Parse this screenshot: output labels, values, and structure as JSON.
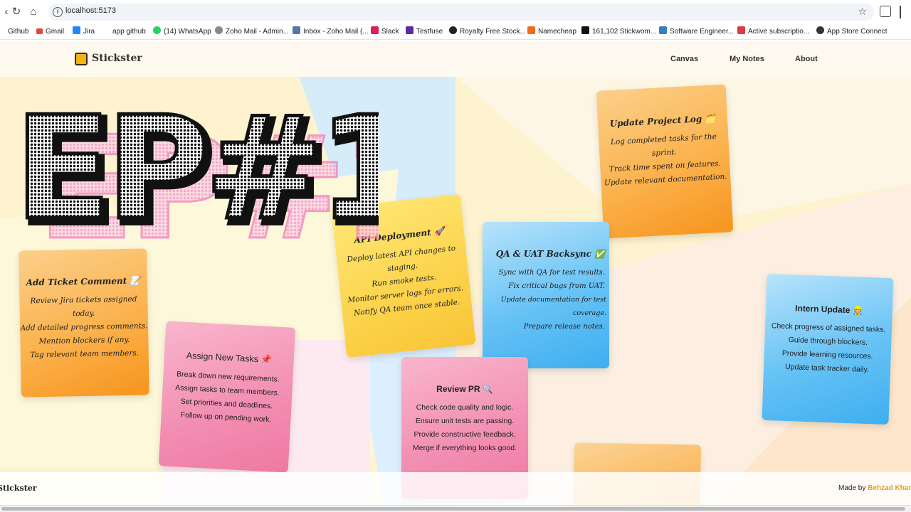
{
  "browser": {
    "url": "localhost:5173",
    "bookmarks": [
      {
        "label": "Github",
        "color": "#333333"
      },
      {
        "label": "Gmail",
        "color": "#ea4335"
      },
      {
        "label": "Jira",
        "color": "#2684ff"
      },
      {
        "label": "app github",
        "color": "#ffffff"
      },
      {
        "label": "(14) WhatsApp",
        "color": "#25d366"
      },
      {
        "label": "Zoho Mail - Admin...",
        "color": "#777777"
      },
      {
        "label": "Inbox - Zoho Mail (...",
        "color": "#5577aa"
      },
      {
        "label": "Slack",
        "color": "#e01e5a"
      },
      {
        "label": "Testfuse",
        "color": "#5a2ca0"
      },
      {
        "label": "Royalty Free Stock...",
        "color": "#222222"
      },
      {
        "label": "Namecheap",
        "color": "#f26a1b"
      },
      {
        "label": "161,102 Stickwom...",
        "color": "#111111"
      },
      {
        "label": "Software Engineer...",
        "color": "#3b7bbf"
      },
      {
        "label": "Active subscriptio...",
        "color": "#e0393e"
      },
      {
        "label": "App Store Connect",
        "color": "#333333"
      }
    ]
  },
  "app": {
    "brand": "Stickster",
    "nav": [
      "Canvas",
      "My Notes",
      "About"
    ],
    "footer_brand": "Stickster",
    "footer_made": "Made by",
    "footer_author": "Behzad Khan"
  },
  "overlay_text": "EP#1",
  "notes": [
    {
      "title": "Update Project Log 🗂️",
      "lines": [
        "Log completed tasks for the sprint.",
        "Track time spent on features.",
        "Update relevant documentation."
      ],
      "color": "orange"
    },
    {
      "title": "API Deployment 🚀",
      "lines": [
        "Deploy latest API changes to staging.",
        "Run smoke tests.",
        "Monitor server logs for errors.",
        "Notify QA team once stable."
      ],
      "color": "yellow"
    },
    {
      "title": "QA & UAT Backsync ✅",
      "lines": [
        "Sync with QA for test results.",
        "Fix critical bugs from UAT.",
        "Update documentation for test coverage.",
        "Prepare release notes."
      ],
      "color": "blue"
    },
    {
      "title": "Add Ticket Comment 📝",
      "lines": [
        "Review Jira tickets assigned today.",
        "Add detailed progress comments.",
        "Mention blockers if any.",
        "Tag relevant team members."
      ],
      "color": "orange"
    },
    {
      "title": "Intern Update 👷",
      "lines": [
        "Check progress of assigned tasks.",
        "Guide through blockers.",
        "Provide learning resources.",
        "Update task tracker daily."
      ],
      "color": "blue"
    },
    {
      "title": "Assign New Tasks 📌",
      "lines": [
        "Break down new requirements.",
        "Assign tasks to team members.",
        "Set priorities and deadlines.",
        "Follow up on pending work."
      ],
      "color": "pink"
    },
    {
      "title": "Review PR 🔍",
      "lines": [
        "Check code quality and logic.",
        "Ensure unit tests are passing.",
        "Provide constructive feedback.",
        "Merge if everything looks good."
      ],
      "color": "pink"
    }
  ]
}
